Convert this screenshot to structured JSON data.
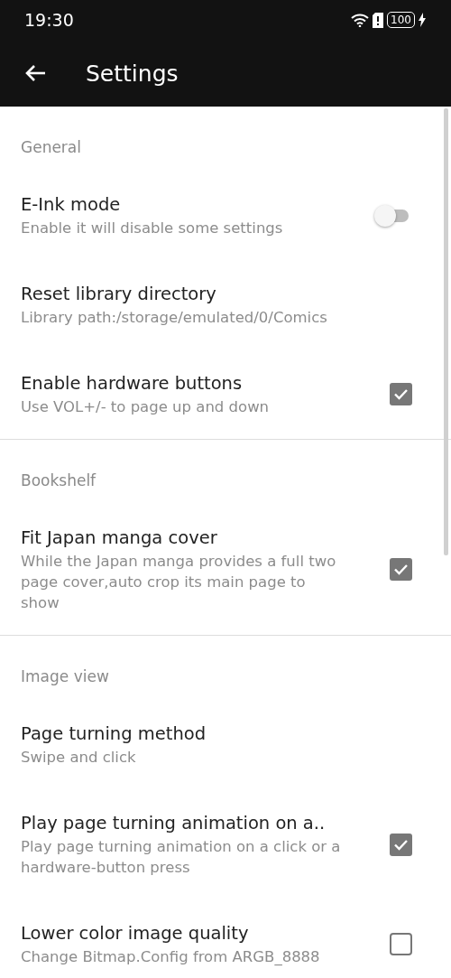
{
  "status_bar": {
    "time": "19:30",
    "battery": "100"
  },
  "app_bar": {
    "title": "Settings"
  },
  "sections": [
    {
      "header": "General",
      "items": [
        {
          "kind": "switch",
          "title": "E-Ink mode",
          "subtitle": "Enable it will disable some settings",
          "on": false
        },
        {
          "kind": "plain",
          "title": "Reset library directory",
          "subtitle": "Library path:/storage/emulated/0/Comics"
        },
        {
          "kind": "checkbox",
          "title": "Enable hardware buttons",
          "subtitle": "Use VOL+/- to page up and down",
          "checked": true
        }
      ]
    },
    {
      "header": "Bookshelf",
      "items": [
        {
          "kind": "checkbox",
          "title": "Fit Japan manga cover",
          "subtitle": "While the Japan manga provides a full two page cover,auto crop its main page to show",
          "checked": true
        }
      ]
    },
    {
      "header": "Image view",
      "items": [
        {
          "kind": "plain",
          "title": "Page turning method",
          "subtitle": "Swipe and click"
        },
        {
          "kind": "checkbox",
          "title": "Play page turning animation on a..",
          "subtitle": "Play page turning animation on a click or a hardware-button press",
          "checked": true
        },
        {
          "kind": "checkbox",
          "title": "Lower color image quality",
          "subtitle": "Change Bitmap.Config from ARGB_8888",
          "checked": false
        }
      ]
    }
  ]
}
